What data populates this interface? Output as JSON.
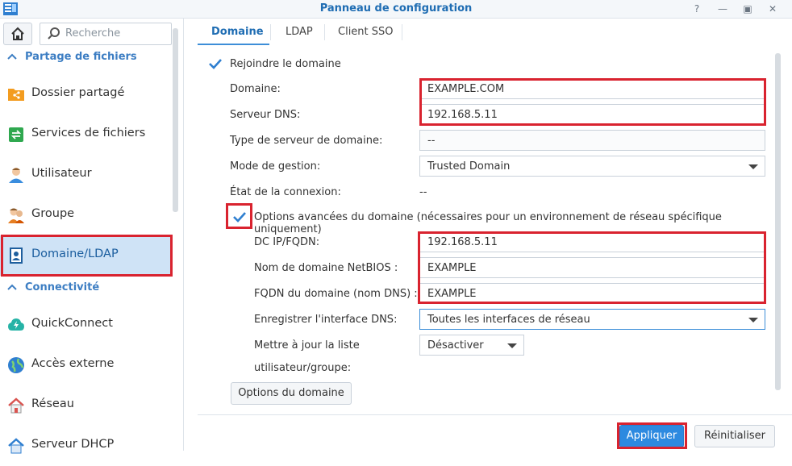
{
  "window": {
    "title": "Panneau de configuration"
  },
  "sidebar": {
    "search_placeholder": "Recherche",
    "sections": [
      {
        "label": "Partage de fichiers"
      },
      {
        "label": "Connectivité"
      }
    ],
    "items": [
      {
        "label": "Dossier partagé",
        "icon": "shared-folder-icon"
      },
      {
        "label": "Services de fichiers",
        "icon": "file-services-icon"
      },
      {
        "label": "Utilisateur",
        "icon": "user-icon"
      },
      {
        "label": "Groupe",
        "icon": "group-icon"
      },
      {
        "label": "Domaine/LDAP",
        "icon": "domain-ldap-icon",
        "active": true
      },
      {
        "label": "QuickConnect",
        "icon": "quickconnect-icon"
      },
      {
        "label": "Accès externe",
        "icon": "external-access-icon"
      },
      {
        "label": "Réseau",
        "icon": "network-icon"
      },
      {
        "label": "Serveur DHCP",
        "icon": "dhcp-server-icon"
      }
    ]
  },
  "tabs": [
    {
      "label": "Domaine",
      "active": true
    },
    {
      "label": "LDAP"
    },
    {
      "label": "Client SSO"
    }
  ],
  "form": {
    "join_domain_label": "Rejoindre le domaine",
    "join_domain_checked": true,
    "domain_label": "Domaine:",
    "domain_value": "EXAMPLE.COM",
    "dns_label": "Serveur DNS:",
    "dns_value": "192.168.5.11",
    "server_type_label": "Type de serveur de domaine:",
    "server_type_value": "--",
    "mgmt_mode_label": "Mode de gestion:",
    "mgmt_mode_value": "Trusted Domain",
    "conn_state_label": "État de la connexion:",
    "conn_state_value": "--",
    "advanced_label": "Options avancées du domaine (nécessaires pour un environnement de réseau spécifique uniquement)",
    "advanced_checked": true,
    "dc_label": "DC IP/FQDN:",
    "dc_value": "192.168.5.11",
    "netbios_label": "Nom de domaine NetBIOS :",
    "netbios_value": "EXAMPLE",
    "fqdn_label": "FQDN du domaine (nom DNS) :",
    "fqdn_value": "EXAMPLE",
    "dns_iface_label": "Enregistrer l'interface DNS:",
    "dns_iface_value": "Toutes les interfaces de réseau",
    "update_list_label_1": "Mettre à jour la liste",
    "update_list_label_2": "utilisateur/groupe:",
    "update_list_value": "Désactiver",
    "domain_options_button": "Options du domaine"
  },
  "footer": {
    "apply_label": "Appliquer",
    "reset_label": "Réinitialiser"
  },
  "colors": {
    "accent": "#3d8ed8",
    "highlight": "#d9232f",
    "active_nav": "#cfe3f6"
  }
}
